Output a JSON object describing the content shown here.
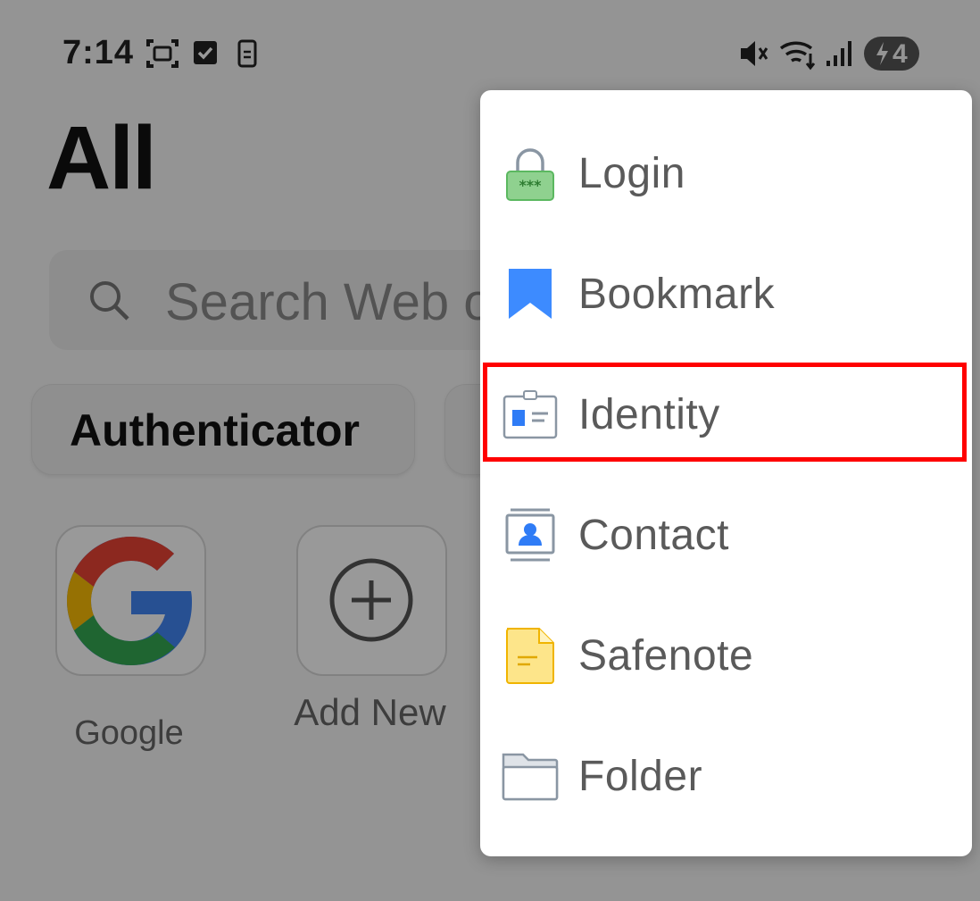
{
  "status_bar": {
    "time": "7:14",
    "battery_level": "4",
    "icons": [
      "screenshot-icon",
      "checkbox-icon",
      "phone-icon",
      "mute-icon",
      "wifi-icon",
      "signal-icon",
      "battery-charging-icon"
    ]
  },
  "page": {
    "title": "All",
    "search_placeholder": "Search Web o"
  },
  "chips": [
    {
      "label": "Authenticator"
    }
  ],
  "tiles": [
    {
      "label": "Google",
      "icon": "google-logo"
    },
    {
      "label": "Add New",
      "icon": "plus-circle-icon"
    }
  ],
  "menu": {
    "items": [
      {
        "label": "Login",
        "icon": "lock-icon",
        "color": "#5bb860"
      },
      {
        "label": "Bookmark",
        "icon": "bookmark-icon",
        "color": "#3d8bff"
      },
      {
        "label": "Identity",
        "icon": "id-card-icon",
        "color": "#2f7cf6",
        "highlighted": true
      },
      {
        "label": "Contact",
        "icon": "contact-card-icon",
        "color": "#2f7cf6"
      },
      {
        "label": "Safenote",
        "icon": "note-icon",
        "color": "#f5c518"
      },
      {
        "label": "Folder",
        "icon": "folder-icon",
        "color": "#8a96a3"
      }
    ]
  },
  "colors": {
    "highlight_border": "#ff0000",
    "menu_text": "#5a5a5a"
  }
}
